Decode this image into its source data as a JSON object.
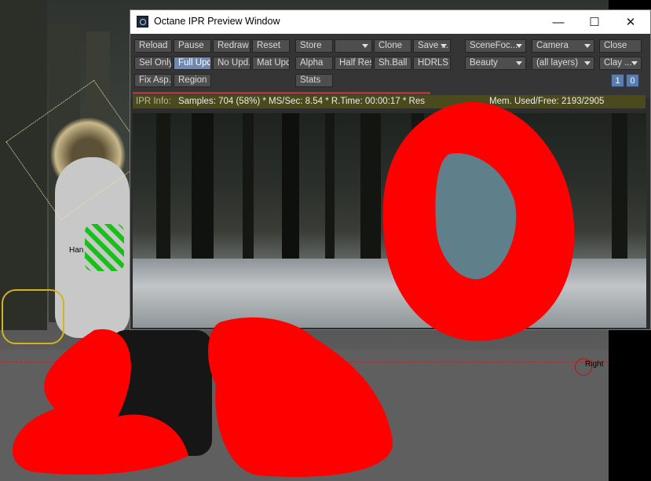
{
  "viewport": {
    "label_right": "Right",
    "label_handle": "Han"
  },
  "window": {
    "title": "Octane IPR Preview Window",
    "minimize": "—",
    "maximize": "☐",
    "close": "✕"
  },
  "toolbar": {
    "reload": "Reload",
    "pause": "Pause",
    "redraw": "Redraw",
    "reset": "Reset",
    "store": "Store",
    "store_slot": "",
    "clone": "Clone",
    "save": "Save ...",
    "scene_focus": "SceneFoc...",
    "camera": "Camera",
    "close": "Close",
    "sel_only": "Sel Only",
    "full_upd": "Full Upd.",
    "no_upd": "No Upd.",
    "mat_upd": "Mat Upd",
    "alpha": "Alpha",
    "half_res": "Half Res",
    "sh_ball": "Sh.Ball",
    "hdrls": "HDRLS",
    "beauty": "Beauty",
    "all_layers": "(all layers)",
    "clay": "Clay ...",
    "fix_asp": "Fix Asp.",
    "region": "Region",
    "stats": "Stats",
    "num_one": "1",
    "num_zero": "0"
  },
  "info": {
    "label": "IPR Info:",
    "text": "Samples: 704 (58%)  *  MS/Sec: 8.54  *  R.Time: 00:00:17  *  Res",
    "mem": "Mem. Used/Free: 2193/2905",
    "progress": 0.58
  },
  "colors": {
    "scribble": "#ff0000",
    "accent": "#6d88b4"
  }
}
